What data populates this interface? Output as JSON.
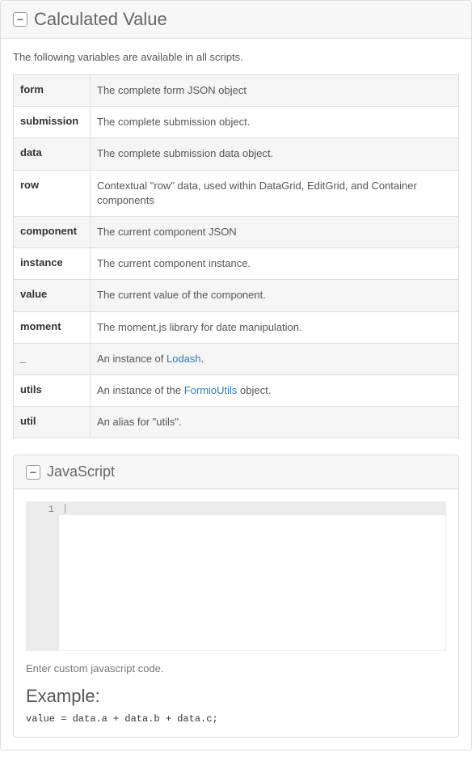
{
  "mainPanel": {
    "title": "Calculated Value",
    "intro": "The following variables are available in all scripts.",
    "vars": [
      {
        "name": "form",
        "desc_pre": "The complete form JSON object",
        "link": "",
        "desc_post": ""
      },
      {
        "name": "submission",
        "desc_pre": "The complete submission object.",
        "link": "",
        "desc_post": ""
      },
      {
        "name": "data",
        "desc_pre": "The complete submission data object.",
        "link": "",
        "desc_post": ""
      },
      {
        "name": "row",
        "desc_pre": "Contextual \"row\" data, used within DataGrid, EditGrid, and Container components",
        "link": "",
        "desc_post": ""
      },
      {
        "name": "component",
        "desc_pre": "The current component JSON",
        "link": "",
        "desc_post": ""
      },
      {
        "name": "instance",
        "desc_pre": "The current component instance.",
        "link": "",
        "desc_post": ""
      },
      {
        "name": "value",
        "desc_pre": "The current value of the component.",
        "link": "",
        "desc_post": ""
      },
      {
        "name": "moment",
        "desc_pre": "The moment.js library for date manipulation.",
        "link": "",
        "desc_post": ""
      },
      {
        "name": "_",
        "desc_pre": "An instance of ",
        "link": "Lodash",
        "desc_post": "."
      },
      {
        "name": "utils",
        "desc_pre": "An instance of the ",
        "link": "FormioUtils",
        "desc_post": " object."
      },
      {
        "name": "util",
        "desc_pre": "An alias for \"utils\".",
        "link": "",
        "desc_post": ""
      }
    ]
  },
  "jsPanel": {
    "title": "JavaScript",
    "lineNumber": "1",
    "helper": "Enter custom javascript code.",
    "exampleHeading": "Example:",
    "exampleCode": "value = data.a + data.b + data.c;"
  },
  "collapseGlyph": "−"
}
